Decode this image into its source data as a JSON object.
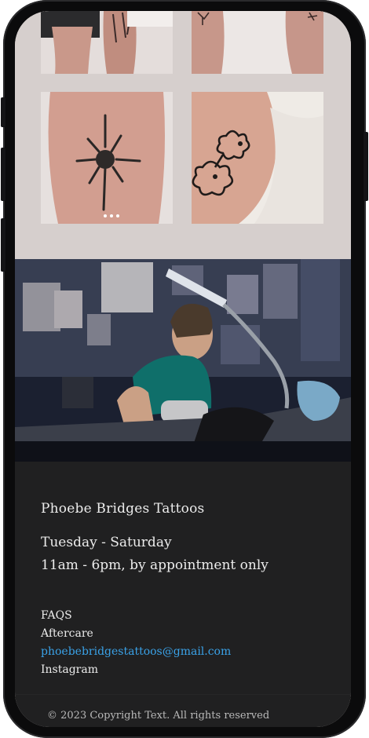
{
  "footer": {
    "brand": "Phoebe Bridges Tattoos",
    "days": "Tuesday - Saturday",
    "hours": "11am - 6pm, by appointment only",
    "links": {
      "faqs": "FAQS",
      "aftercare": "Aftercare",
      "email": "phoebebridgestattoos@gmail.com",
      "instagram": "Instagram"
    },
    "copyright": "© 2023 Copyright Text. All rights reserved"
  },
  "colors": {
    "background": "#d6cfcd",
    "footer_bg": "#202021",
    "link_accent": "#3aa2e8"
  }
}
